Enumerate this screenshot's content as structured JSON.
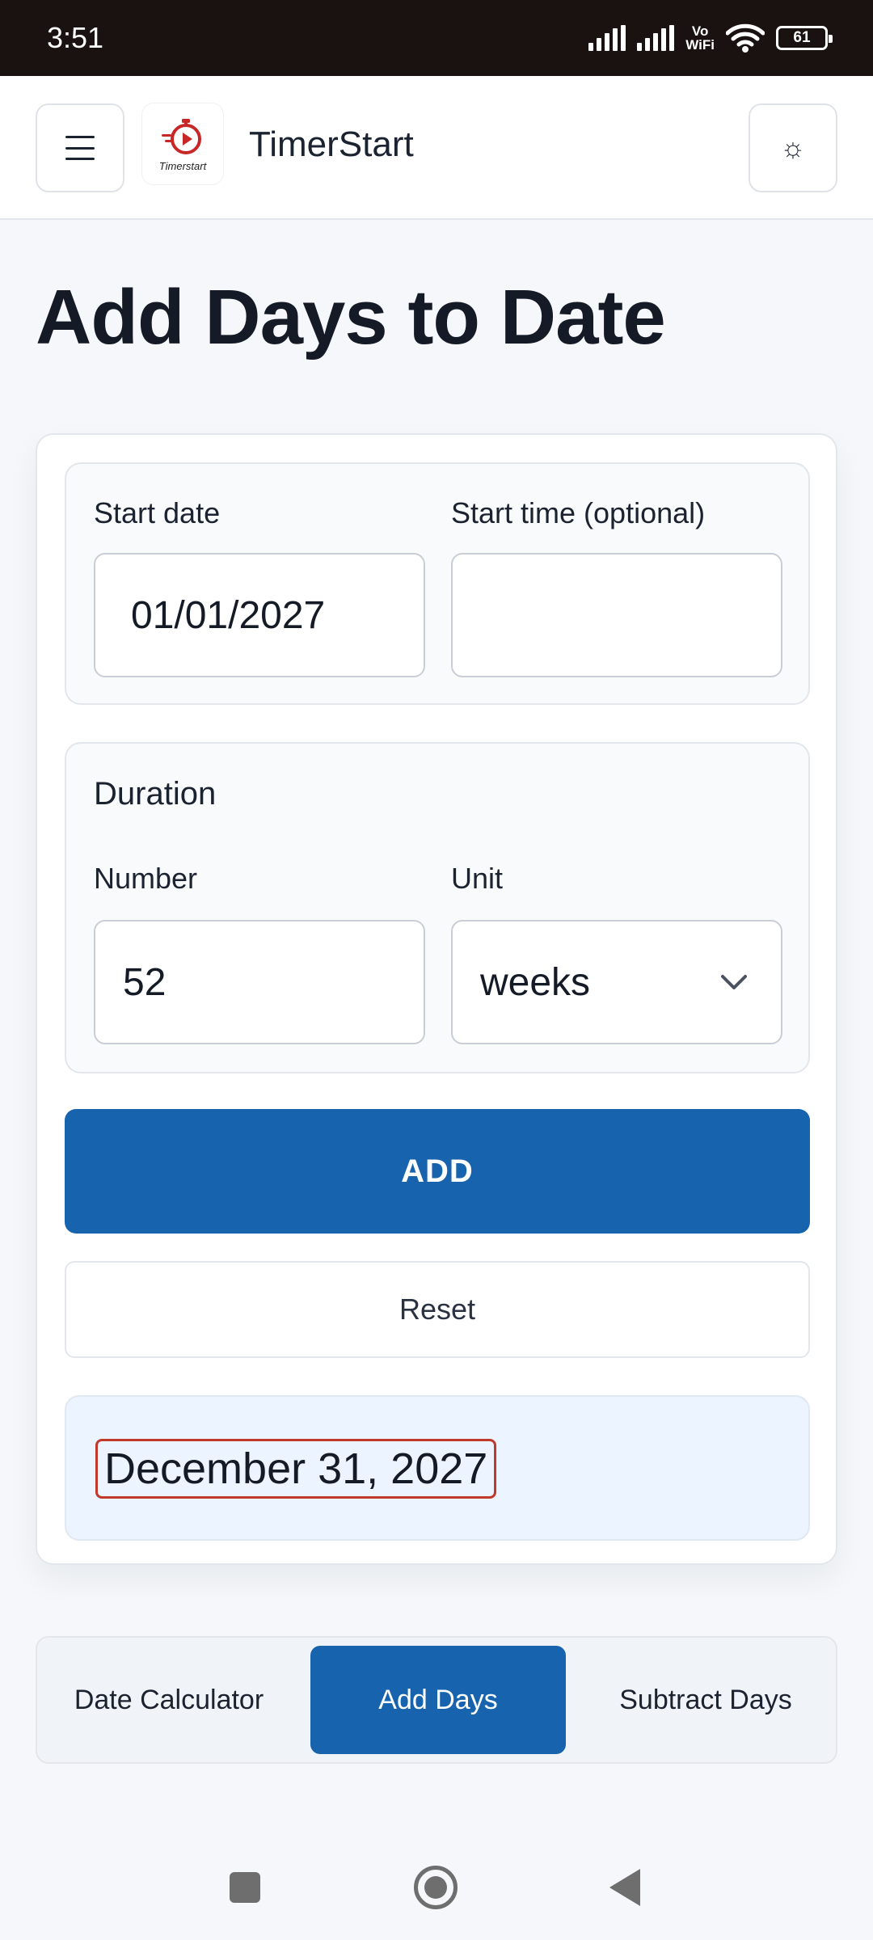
{
  "status_bar": {
    "time": "3:51",
    "network_label_top": "Vo",
    "network_label_bottom": "WiFi",
    "battery": "61"
  },
  "header": {
    "app_name": "TimerStart",
    "logo_caption": "Timerstart",
    "theme_icon": "☼",
    "accent_color": "#1763ae"
  },
  "page": {
    "title": "Add Days to Date"
  },
  "form": {
    "start_date_label": "Start date",
    "start_date_value": "01/01/2027",
    "start_time_label": "Start time (optional)",
    "start_time_value": "",
    "duration_title": "Duration",
    "number_label": "Number",
    "number_value": "52",
    "unit_label": "Unit",
    "unit_value": "weeks",
    "add_button": "ADD",
    "reset_button": "Reset"
  },
  "result": {
    "text": "December 31, 2027"
  },
  "tabs": [
    {
      "label": "Date Calculator",
      "active": false
    },
    {
      "label": "Add Days",
      "active": true
    },
    {
      "label": "Subtract Days",
      "active": false
    }
  ]
}
